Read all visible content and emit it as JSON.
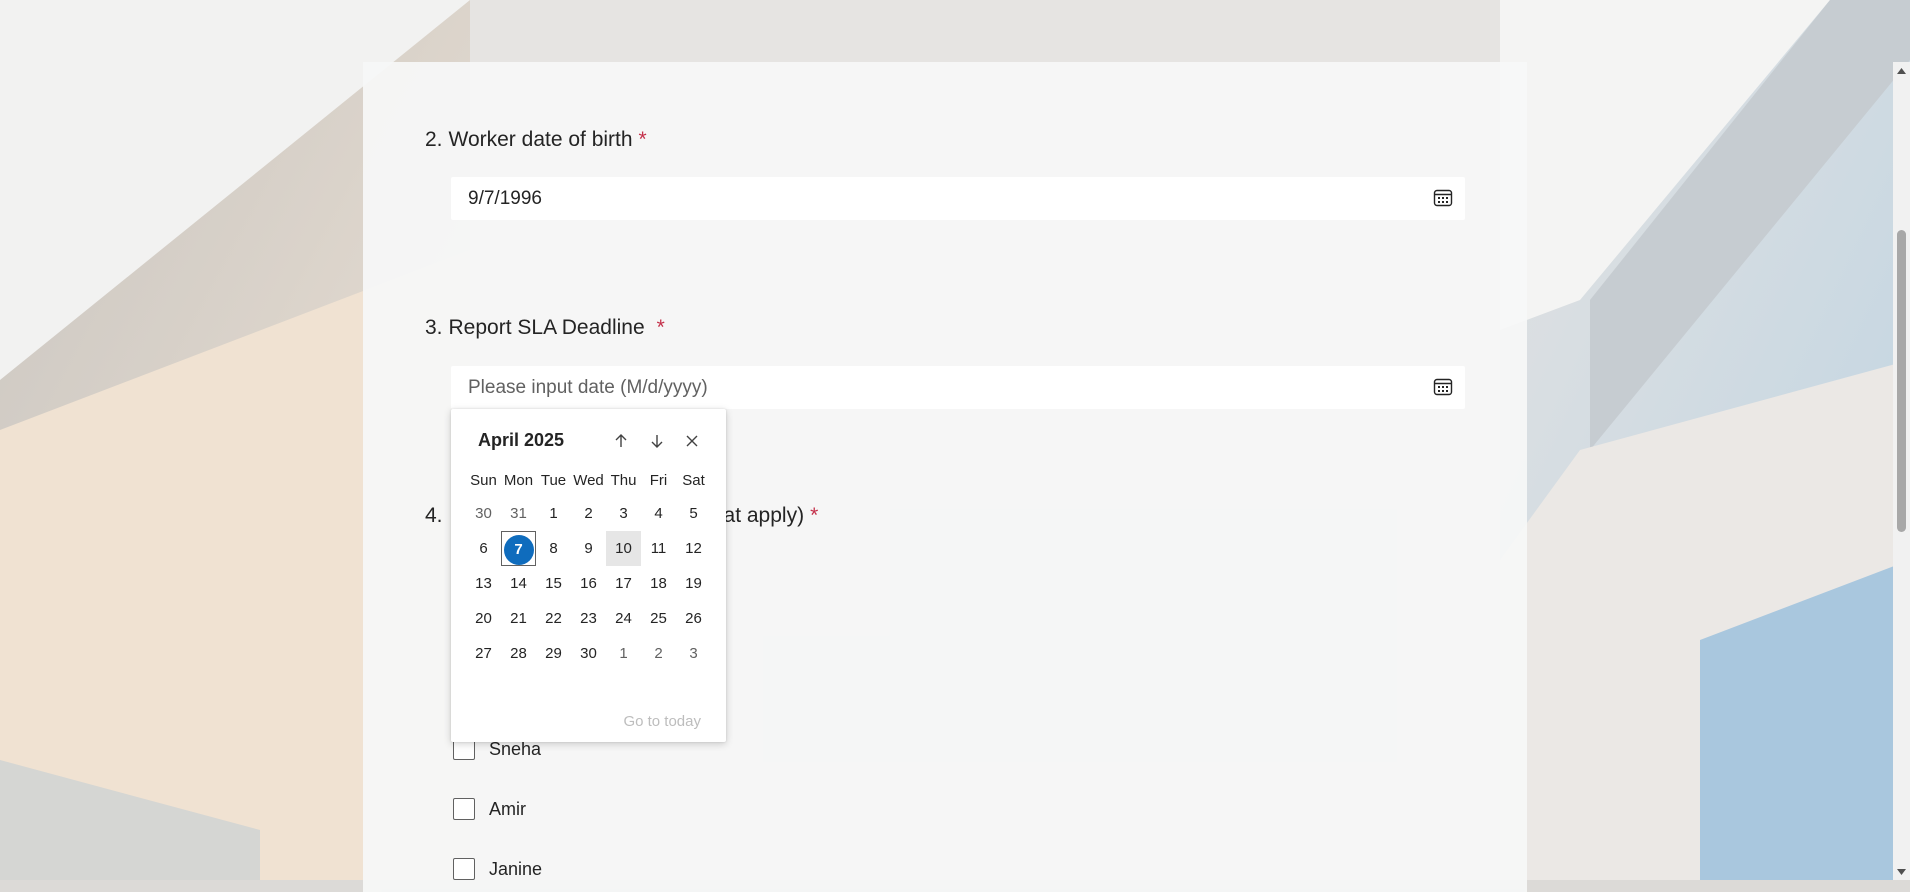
{
  "colors": {
    "required_asterisk": "#c4314b",
    "selected_date": "#0f6cbd",
    "today_highlight": "#e6e6e6"
  },
  "questions": {
    "q2": {
      "number": "2.",
      "title": "Worker date of birth",
      "required": "*",
      "value": "9/7/1996"
    },
    "q3": {
      "number": "3.",
      "title": "Report SLA Deadline",
      "required": "*",
      "placeholder": "Please input date (M/d/yyyy)"
    },
    "q4": {
      "number": "4.",
      "title_visible_end": "at apply)",
      "required": "*"
    }
  },
  "choices": [
    "Sneha",
    "Amir",
    "Janine"
  ],
  "icons": {
    "date_picker": "calendar-icon",
    "prev_month": "arrow-up-icon",
    "next_month": "arrow-down-icon",
    "close": "close-icon",
    "scroll_up": "scroll-up-arrow-icon",
    "scroll_down": "scroll-down-arrow-icon"
  },
  "calendar": {
    "month_label": "April 2025",
    "weekdays": [
      "Sun",
      "Mon",
      "Tue",
      "Wed",
      "Thu",
      "Fri",
      "Sat"
    ],
    "weeks": [
      [
        "30",
        "31",
        "1",
        "2",
        "3",
        "4",
        "5"
      ],
      [
        "6",
        "7",
        "8",
        "9",
        "10",
        "11",
        "12"
      ],
      [
        "13",
        "14",
        "15",
        "16",
        "17",
        "18",
        "19"
      ],
      [
        "20",
        "21",
        "22",
        "23",
        "24",
        "25",
        "26"
      ],
      [
        "27",
        "28",
        "29",
        "30",
        "1",
        "2",
        "3"
      ]
    ],
    "selected_day": "7",
    "today_day": "10",
    "go_to_today": "Go to today"
  }
}
